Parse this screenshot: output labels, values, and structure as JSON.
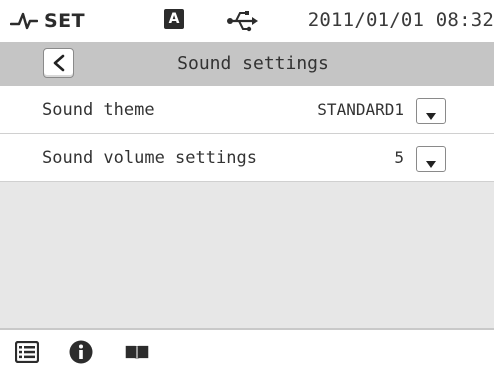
{
  "status_bar": {
    "mode_icon": "function-icon",
    "mode_label": "SET",
    "badge": "A",
    "usb_icon": "usb-icon",
    "datetime": "2011/01/01 08:32"
  },
  "title_bar": {
    "back_icon": "chevron-left-icon",
    "title": "Sound settings"
  },
  "settings": [
    {
      "label": "Sound theme",
      "value": "STANDARD1",
      "control_icon": "dropdown-arrow-icon"
    },
    {
      "label": "Sound volume settings",
      "value": "5",
      "control_icon": "dropdown-arrow-icon"
    }
  ],
  "bottom_bar": {
    "icons": [
      "list-icon",
      "info-icon",
      "manual-icon"
    ]
  },
  "colors": {
    "status_bg": "#ffffff",
    "title_bg": "#c5c5c5",
    "row_bg": "#ffffff",
    "empty_bg": "#e7e7e7",
    "icon_dark": "#2c2c2c"
  }
}
